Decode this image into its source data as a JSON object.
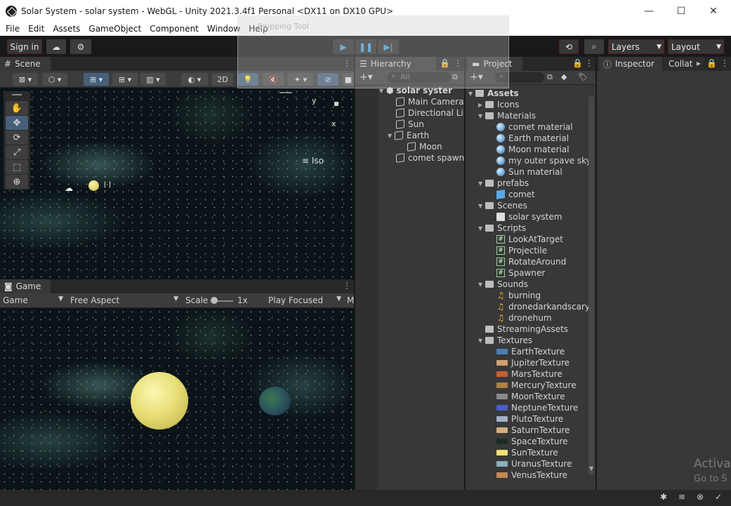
{
  "window": {
    "title": "Solar System - solar system - WebGL - Unity 2021.3.4f1 Personal <DX11 on DX10 GPU>",
    "minimize": "—",
    "maximize": "☐",
    "close": "✕"
  },
  "menu": [
    "File",
    "Edit",
    "Assets",
    "GameObject",
    "Component",
    "Window",
    "Help"
  ],
  "snipping_tool": "Snipping Tool",
  "toolbar": {
    "sign_in": "Sign in",
    "layers": "Layers",
    "layout": "Layout"
  },
  "scene": {
    "tab": "Scene",
    "twod": "2D",
    "axis_y": "y",
    "axis_x": "x",
    "iso": "Iso"
  },
  "game": {
    "tab": "Game",
    "display": "Game",
    "aspect": "Free Aspect",
    "scale_label": "Scale",
    "scale_value": "1x",
    "play_mode": "Play Focused",
    "more": "M"
  },
  "hierarchy": {
    "tab": "Hierarchy",
    "search_placeholder": "All",
    "scene_name": "solar syster",
    "items": [
      {
        "label": "Main Camera",
        "depth": 1
      },
      {
        "label": "Directional Li",
        "depth": 1
      },
      {
        "label": "Sun",
        "depth": 1
      },
      {
        "label": "Earth",
        "depth": 1
      },
      {
        "label": "Moon",
        "depth": 2
      },
      {
        "label": "comet spawn",
        "depth": 1
      }
    ]
  },
  "project": {
    "tab": "Project",
    "assets": "Assets",
    "icons": "Icons",
    "materials": "Materials",
    "material_items": [
      "comet material",
      "Earth material",
      "Moon material",
      "my outer spave sky",
      "Sun material"
    ],
    "prefabs": "prefabs",
    "prefab_items": [
      "comet"
    ],
    "scenes": "Scenes",
    "scene_items": [
      "solar system"
    ],
    "scripts": "Scripts",
    "script_items": [
      "LookAtTarget",
      "Projectile",
      "RotateAround",
      "Spawner"
    ],
    "sounds": "Sounds",
    "sound_items": [
      "burning",
      "dronedarkandscary",
      "dronehum"
    ],
    "streaming": "StreamingAssets",
    "textures": "Textures",
    "texture_items": [
      {
        "label": "EarthTexture",
        "color": "#4a7fb0"
      },
      {
        "label": "JupiterTexture",
        "color": "#d0a070"
      },
      {
        "label": "MarsTexture",
        "color": "#c0603a"
      },
      {
        "label": "MercuryTexture",
        "color": "#b08040"
      },
      {
        "label": "MoonTexture",
        "color": "#8a8a8a"
      },
      {
        "label": "NeptuneTexture",
        "color": "#4a5fc8"
      },
      {
        "label": "PlutoTexture",
        "color": "#a0b0c8"
      },
      {
        "label": "SaturnTexture",
        "color": "#d4b080"
      },
      {
        "label": "SpaceTexture",
        "color": "#1c2a2a"
      },
      {
        "label": "SunTexture",
        "color": "#f0e070"
      },
      {
        "label": "UranusTexture",
        "color": "#8ab0c0"
      },
      {
        "label": "VenusTexture",
        "color": "#c08850"
      }
    ]
  },
  "inspector": {
    "tab": "Inspector",
    "collab": "Collat"
  },
  "watermark": {
    "line1": "Activa",
    "line2": "Go to S"
  }
}
